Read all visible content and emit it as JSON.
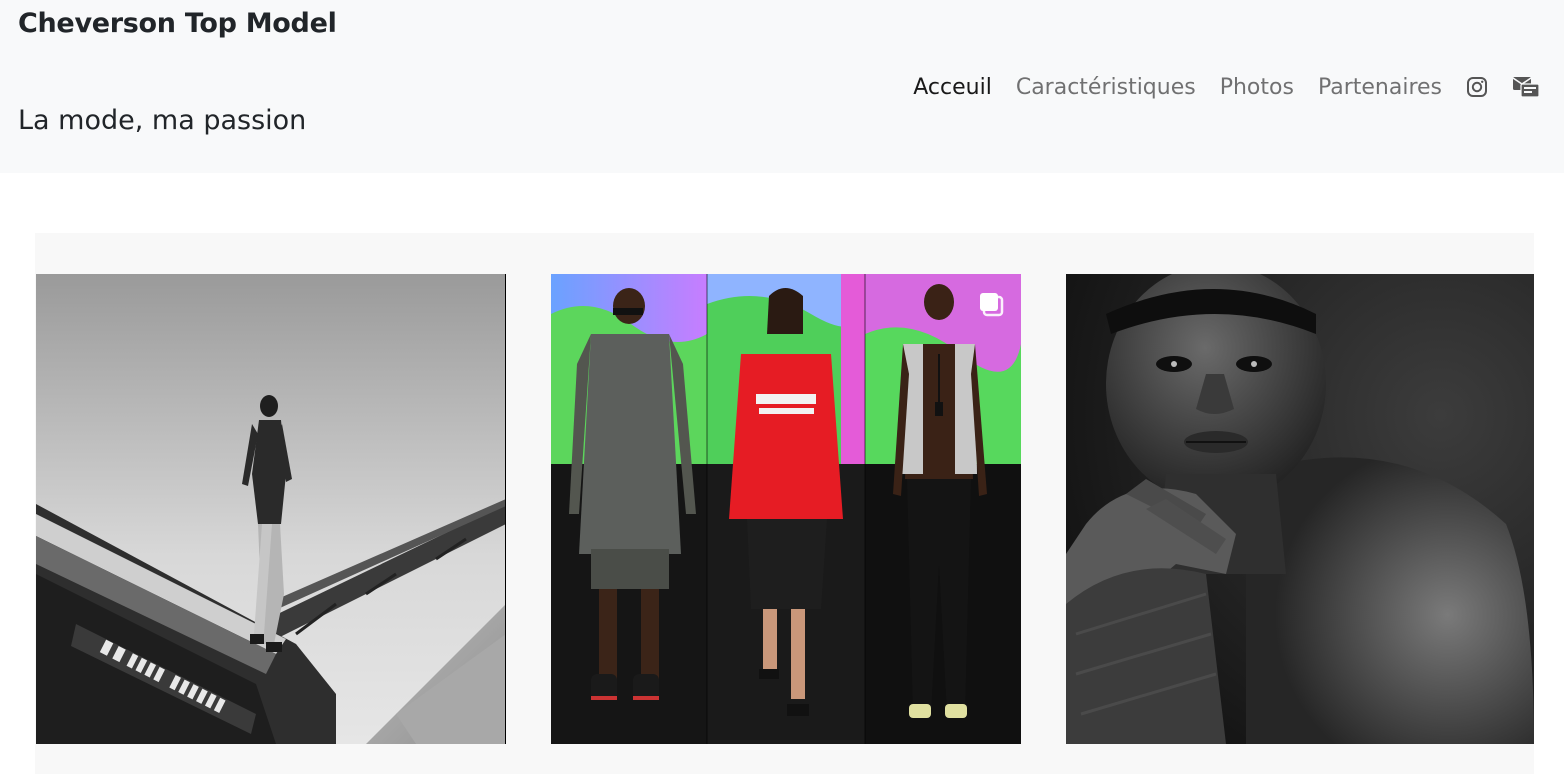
{
  "header": {
    "brand": "Cheverson Top Model",
    "tagline": "La mode, ma passion"
  },
  "nav": {
    "items": [
      {
        "label": "Acceuil",
        "active": true
      },
      {
        "label": "Caractéristiques",
        "active": false
      },
      {
        "label": "Photos",
        "active": false
      },
      {
        "label": "Partenaires",
        "active": false
      }
    ],
    "icons": [
      "instagram-icon",
      "mail-icon"
    ]
  },
  "gallery": {
    "photos": [
      {
        "icon": "photo-bw-industrial"
      },
      {
        "icon": "photo-runway-collage",
        "badge": "multiple-images-icon"
      },
      {
        "icon": "photo-bw-portrait"
      }
    ]
  },
  "colors": {
    "navbar_bg": "#f8f9fa",
    "gallery_bg": "#f8f8f8",
    "text": "#212529",
    "nav_muted": "rgba(0,0,0,0.55)"
  }
}
